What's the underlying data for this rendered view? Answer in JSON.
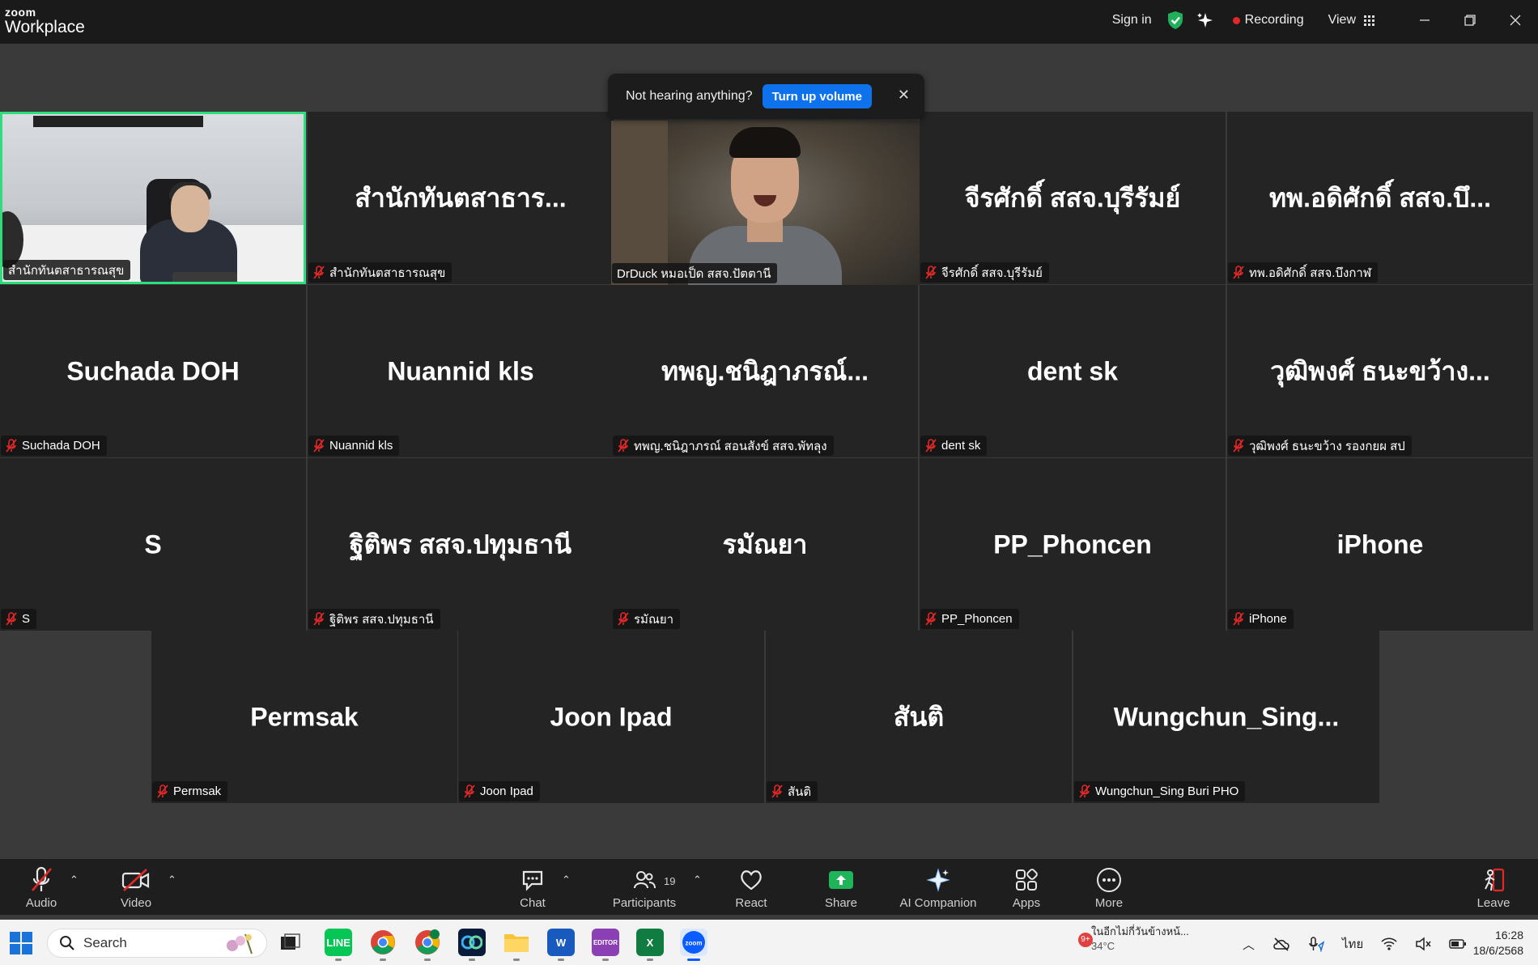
{
  "app": {
    "brand_small": "zoom",
    "brand_large": "Workplace"
  },
  "titlebar": {
    "sign_in": "Sign in",
    "recording": "Recording",
    "view": "View",
    "window_controls": [
      "minimize",
      "restore",
      "close"
    ]
  },
  "toast": {
    "message": "Not hearing anything?",
    "action": "Turn up volume"
  },
  "tiles": [
    {
      "display": "",
      "label": "สำนักทันตสาธารณสุข",
      "video": true
    },
    {
      "display": "สำนักทันตสาธาร...",
      "label": "สำนักทันตสาธารณสุข",
      "video": false
    },
    {
      "display": "",
      "label": "DrDuck หมอเป็ด สสจ.ปัตตานี",
      "video": true
    },
    {
      "display": "จีรศักดิ์ สสจ.บุรีรัมย์",
      "label": "จีรศักดิ์ สสจ.บุรีรัมย์",
      "video": false
    },
    {
      "display": "ทพ.อดิศักดิ์ สสจ.บึ...",
      "label": "ทพ.อดิศักดิ์ สสจ.บึงกาฬ",
      "video": false
    },
    {
      "display": "Suchada DOH",
      "label": "Suchada DOH",
      "video": false
    },
    {
      "display": "Nuannid  kls",
      "label": "Nuannid  kls",
      "video": false
    },
    {
      "display": "ทพญ.ชนิฎาภรณ์...",
      "label": "ทพญ.ชนิฎาภรณ์ สอนสังข์ สสจ.พัทลุง",
      "video": false
    },
    {
      "display": "dent sk",
      "label": "dent sk",
      "video": false
    },
    {
      "display": "วุฒิพงศ์ ธนะขว้าง...",
      "label": "วุฒิพงศ์ ธนะขว้าง รองกยผ สป",
      "video": false
    },
    {
      "display": "S",
      "label": "S",
      "video": false
    },
    {
      "display": "ฐิติพร สสจ.ปทุมธานี",
      "label": "ฐิติพร สสจ.ปทุมธานี",
      "video": false
    },
    {
      "display": "รมัณยา",
      "label": "รมัณยา",
      "video": false
    },
    {
      "display": "PP_Phoncen",
      "label": "PP_Phoncen",
      "video": false
    },
    {
      "display": "iPhone",
      "label": "iPhone",
      "video": false
    },
    {
      "display": "Permsak",
      "label": "Permsak",
      "video": false
    },
    {
      "display": "Joon Ipad",
      "label": "Joon Ipad",
      "video": false
    },
    {
      "display": "สันติ",
      "label": "สันติ",
      "video": false
    },
    {
      "display": "Wungchun_Sing...",
      "label": "Wungchun_Sing Buri PHO",
      "video": false
    }
  ],
  "toolbar": {
    "audio": "Audio",
    "video": "Video",
    "chat": "Chat",
    "participants": "Participants",
    "participants_count": "19",
    "react": "React",
    "share": "Share",
    "ai_companion": "AI Companion",
    "apps": "Apps",
    "more": "More",
    "leave": "Leave"
  },
  "taskbar": {
    "search_placeholder": "Search",
    "weather_text": "ในอีกไม่กี่วันข้างหน้...",
    "weather_temp": "34°C",
    "weather_badge": "9+",
    "language": "ไทย",
    "time": "16:28",
    "date": "18/6/2568",
    "apps": [
      "task-view",
      "line",
      "chrome",
      "chrome-profile",
      "webex",
      "file-explorer",
      "word",
      "editor",
      "excel",
      "zoom"
    ]
  },
  "colors": {
    "accent_blue": "#0e72ed",
    "active_speaker": "#2ede7d",
    "recording_red": "#e02828",
    "muted_red": "#e02828",
    "share_green": "#1fb45a"
  }
}
